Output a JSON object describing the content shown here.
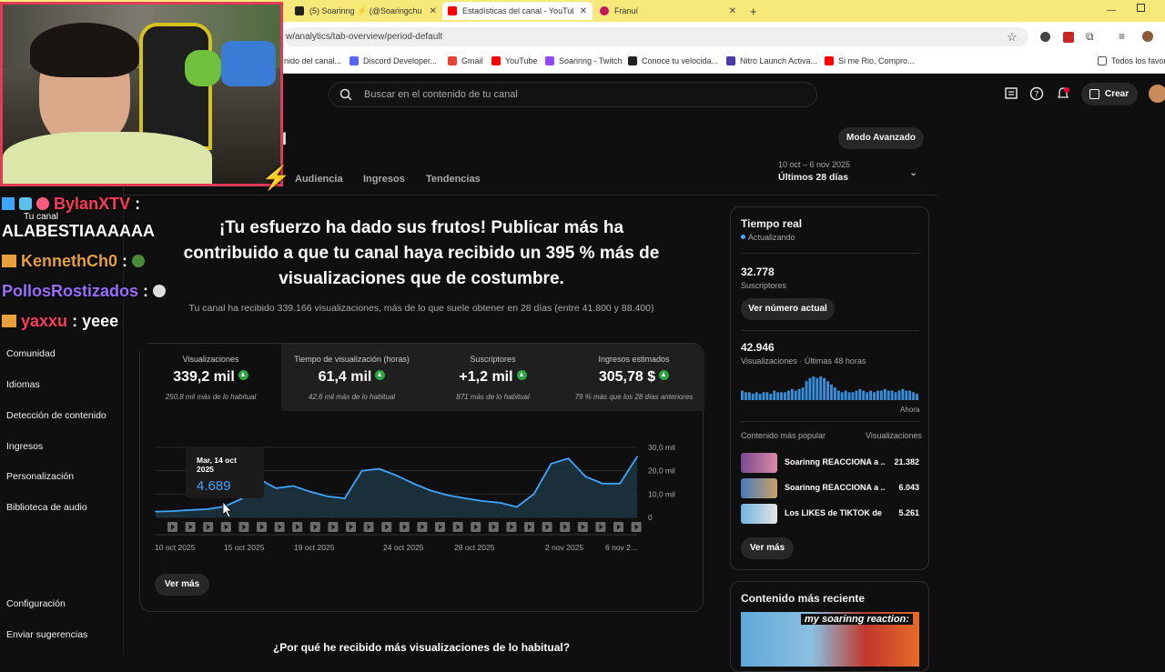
{
  "browser": {
    "tabs": [
      {
        "label": "(5) Soarinng ⚡ (@Soaringchu",
        "color": "#222222"
      },
      {
        "label": "Estadísticas del canal - YouTube",
        "color": "#ff0000"
      },
      {
        "label": "Franuí",
        "color": "#c2185b"
      }
    ],
    "new_tab": "+",
    "url": "w/analytics/tab-overview/period-default",
    "bookmarks": [
      {
        "label": "nido del canal...",
        "color": "#ff0000"
      },
      {
        "label": "Discord Developer...",
        "color": "#5865f2"
      },
      {
        "label": "Gmail",
        "color": "#ea4335"
      },
      {
        "label": "YouTube",
        "color": "#ff0000"
      },
      {
        "label": "Soarinng - Twitch",
        "color": "#9146ff"
      },
      {
        "label": "Conoce tu velocida...",
        "color": "#222222"
      },
      {
        "label": "Nitro Launch Activa...",
        "color": "#4a3aa8"
      },
      {
        "label": "Si me Rio, Compro...",
        "color": "#ff0000"
      }
    ],
    "bookmarks_all": "Todos los favori"
  },
  "header": {
    "search_placeholder": "Buscar en el contenido de tu canal",
    "create_label": "Crear"
  },
  "title_partial": "l",
  "advanced_mode": "Modo Avanzado",
  "date_range": {
    "range": "10 oct – 6 nov 2025",
    "label": "Últimos 28 días"
  },
  "tabs": [
    "Audiencia",
    "Ingresos",
    "Tendencias"
  ],
  "sidebar": {
    "items": [
      "Comunidad",
      "Idiomas",
      "Detección de contenido",
      "Ingresos",
      "Personalización",
      "Biblioteca de audio"
    ],
    "bottom": [
      "Configuración",
      "Enviar sugerencias"
    ]
  },
  "headline": "¡Tu esfuerzo ha dado sus frutos! Publicar más ha contribuido a que tu canal haya recibido un 395 % más de visualizaciones que de costumbre.",
  "subline": "Tu canal ha recibido 339.166 visualizaciones, más de lo que suele obtener en 28 días (entre 41.800 y 88.400)",
  "metrics": [
    {
      "label": "Visualizaciones",
      "value": "339,2 mil",
      "sub": "250,8 mil más de lo habitual"
    },
    {
      "label": "Tiempo de visualización (horas)",
      "value": "61,4 mil",
      "sub": "42,6 mil más de lo habitual"
    },
    {
      "label": "Suscriptores",
      "value": "+1,2 mil",
      "sub": "871 más de lo habitual"
    },
    {
      "label": "Ingresos estimados",
      "value": "305,78 $",
      "sub": "79 % más que los 28 días anteriores"
    }
  ],
  "tooltip": {
    "date": "Mar, 14 oct 2025",
    "value": "4.689"
  },
  "chart_data": {
    "type": "area",
    "x_ticks": [
      "10 oct 2025",
      "15 oct 2025",
      "19 oct 2025",
      "24 oct 2025",
      "28 oct 2025",
      "2 nov 2025",
      "6 nov 2..."
    ],
    "y_ticks": [
      "0",
      "10,0 mil",
      "20,0 mil",
      "30,0 mil"
    ],
    "ylim": [
      0,
      30000
    ],
    "series": [
      {
        "values": [
          2500,
          2700,
          3200,
          3500,
          4689,
          8000,
          16500,
          12500,
          13500,
          11000,
          9000,
          8200,
          20000,
          20800,
          18000,
          14500,
          11500,
          9500,
          8200,
          7000,
          6300,
          4500,
          10000,
          23000,
          25300,
          17500,
          14500,
          14500,
          26000
        ]
      }
    ],
    "color": "#3ea6ff"
  },
  "chart_more": "Ver más",
  "why": "¿Por qué he recibido más visualizaciones de lo habitual?",
  "realtime": {
    "title": "Tiempo real",
    "status": "Actualizando",
    "subs_value": "32.778",
    "subs_label": "Suscriptores",
    "subs_button": "Ver número actual",
    "views_value": "42.946",
    "views_label": "Visualizaciones · Últimas 48 horas",
    "now_label": "Ahora",
    "bars": [
      6,
      5,
      5,
      4,
      5,
      4,
      5,
      5,
      4,
      6,
      5,
      5,
      5,
      6,
      7,
      6,
      7,
      8,
      12,
      14,
      15,
      14,
      15,
      14,
      12,
      10,
      8,
      6,
      5,
      6,
      5,
      5,
      6,
      7,
      6,
      5,
      6,
      5,
      6,
      6,
      7,
      6,
      6,
      5,
      6,
      7,
      6,
      6,
      5,
      4
    ],
    "top_title": "Contenido más popular",
    "top_col": "Visualizaciones",
    "videos": [
      {
        "title": "Soarinng REACCIONA a ...",
        "views": "21.382"
      },
      {
        "title": "Soarinng REACCIONA a ...",
        "views": "6.043"
      },
      {
        "title": "Los LIKES de TIKTOK de ...",
        "views": "5.261"
      }
    ],
    "more": "Ver más"
  },
  "recent": {
    "title": "Contenido más reciente",
    "thumb_text": "my soarinng reaction:"
  },
  "overlay": {
    "chat": [
      {
        "user": "BylanXTV",
        "msg": ":",
        "color": "#ff3b5c"
      },
      {
        "user": "",
        "msg": "ALABESTIAAAAAA",
        "color": "#ffffff"
      },
      {
        "user": "KennethCh0",
        "msg": ":",
        "color": "#e8a13a"
      },
      {
        "user": "PollosRostizados",
        "msg": ":",
        "color": "#9d6cff"
      },
      {
        "user": "yaxxu",
        "msg": ": yeee",
        "color": "#ff3b5c"
      }
    ],
    "tu_canal": "Tu canal"
  }
}
